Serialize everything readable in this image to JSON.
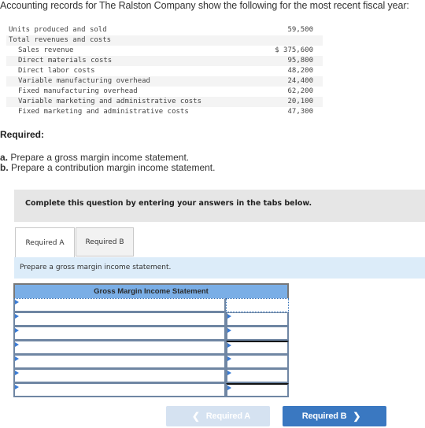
{
  "intro": "Accounting records for The Ralston Company show the following for the most recent fiscal year:",
  "records": [
    {
      "label": "Units produced and sold",
      "value": "59,500",
      "indent": false
    },
    {
      "label": "Total revenues and costs",
      "value": "",
      "indent": false
    },
    {
      "label": "Sales revenue",
      "value": "$ 375,600",
      "indent": true
    },
    {
      "label": "Direct materials costs",
      "value": "95,800",
      "indent": true
    },
    {
      "label": "Direct labor costs",
      "value": "48,200",
      "indent": true
    },
    {
      "label": "Variable manufacturing overhead",
      "value": "24,400",
      "indent": true
    },
    {
      "label": "Fixed manufacturing overhead",
      "value": "62,200",
      "indent": true
    },
    {
      "label": "Variable marketing and administrative costs",
      "value": "20,100",
      "indent": true
    },
    {
      "label": "Fixed marketing and administrative costs",
      "value": "47,300",
      "indent": true
    }
  ],
  "required": {
    "title": "Required:",
    "items": [
      {
        "letter": "a.",
        "text": " Prepare a gross margin income statement."
      },
      {
        "letter": "b.",
        "text": " Prepare a contribution margin income statement."
      }
    ]
  },
  "instruction": "Complete this question by entering your answers in the tabs below.",
  "tabs": [
    {
      "label": "Required A",
      "active": true
    },
    {
      "label": "Required B",
      "active": false
    }
  ],
  "prompt": "Prepare a gross margin income statement.",
  "statement": {
    "title": "Gross Margin Income Statement",
    "rows": [
      {
        "label": "",
        "amount": ""
      },
      {
        "label": "",
        "amount": ""
      },
      {
        "label": "",
        "amount": ""
      },
      {
        "label": "",
        "amount": ""
      },
      {
        "label": "",
        "amount": ""
      },
      {
        "label": "",
        "amount": ""
      },
      {
        "label": "",
        "amount": ""
      }
    ]
  },
  "nav": {
    "prev_label": "Required A",
    "next_label": "Required B",
    "prev_icon": "chevron-left-icon",
    "next_icon": "chevron-right-icon"
  },
  "colors": {
    "accent": "#3a78c1",
    "header_blue": "#7aaee6",
    "prompt_bg": "#dcecf9"
  }
}
